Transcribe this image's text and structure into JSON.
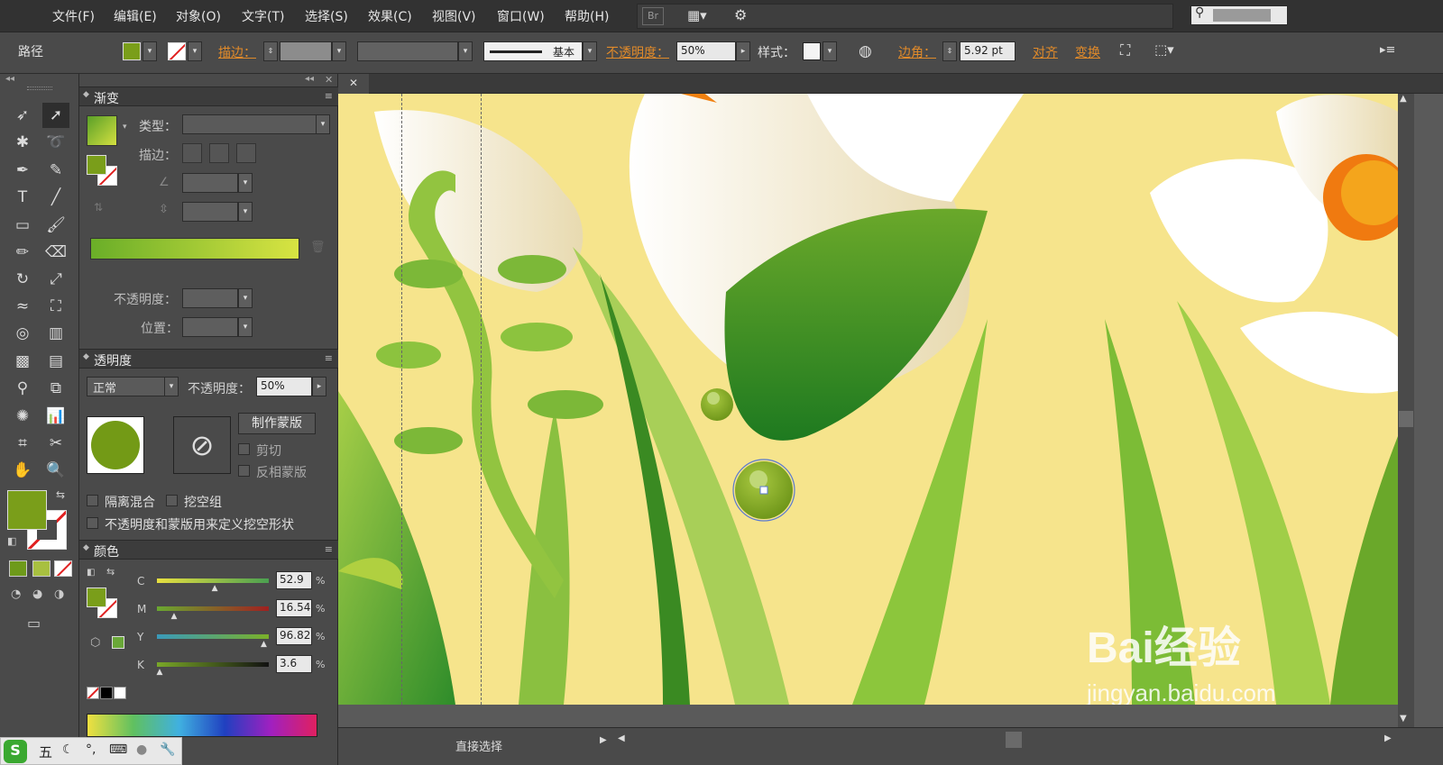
{
  "menu": [
    "文件(F)",
    "编辑(E)",
    "对象(O)",
    "文字(T)",
    "选择(S)",
    "效果(C)",
    "视图(V)",
    "窗口(W)",
    "帮助(H)"
  ],
  "menubar_badges": {
    "bridge": "Br"
  },
  "control_bar": {
    "object_type": "路径",
    "stroke_label": "描边：",
    "brush_label": "基本",
    "opacity_label": "不透明度：",
    "opacity_value": "50%",
    "style_label": "样式：",
    "corner_label": "边角：",
    "corner_value": "5.92 pt",
    "align_label": "对齐",
    "transform_label": "变换",
    "fill_color": "#7a9e1a"
  },
  "gradient_panel": {
    "title": "渐变",
    "type_label": "类型：",
    "stroke_label": "描边：",
    "opacity_label": "不透明度：",
    "position_label": "位置："
  },
  "transparency_panel": {
    "title": "透明度",
    "blend_mode": "正常",
    "opacity_label": "不透明度：",
    "opacity_value": "50%",
    "make_mask": "制作蒙版",
    "clip": "剪切",
    "invert_mask": "反相蒙版",
    "isolate_blending": "隔离混合",
    "knockout_group": "挖空组",
    "opacity_mask_define_knockout": "不透明度和蒙版用来定义挖空形状"
  },
  "color_panel": {
    "title": "颜色",
    "channels": [
      {
        "name": "C",
        "value": "52.9",
        "pct": 52.9
      },
      {
        "name": "M",
        "value": "16.54",
        "pct": 16.54
      },
      {
        "name": "Y",
        "value": "96.82",
        "pct": 96.82
      },
      {
        "name": "K",
        "value": "3.6",
        "pct": 3.6
      }
    ],
    "unit": "%"
  },
  "status": {
    "tool": "直接选择"
  },
  "watermark": {
    "logo": "Bai经验",
    "url": "jingyan.baidu.com"
  },
  "ime_bar": {
    "label": "五"
  }
}
